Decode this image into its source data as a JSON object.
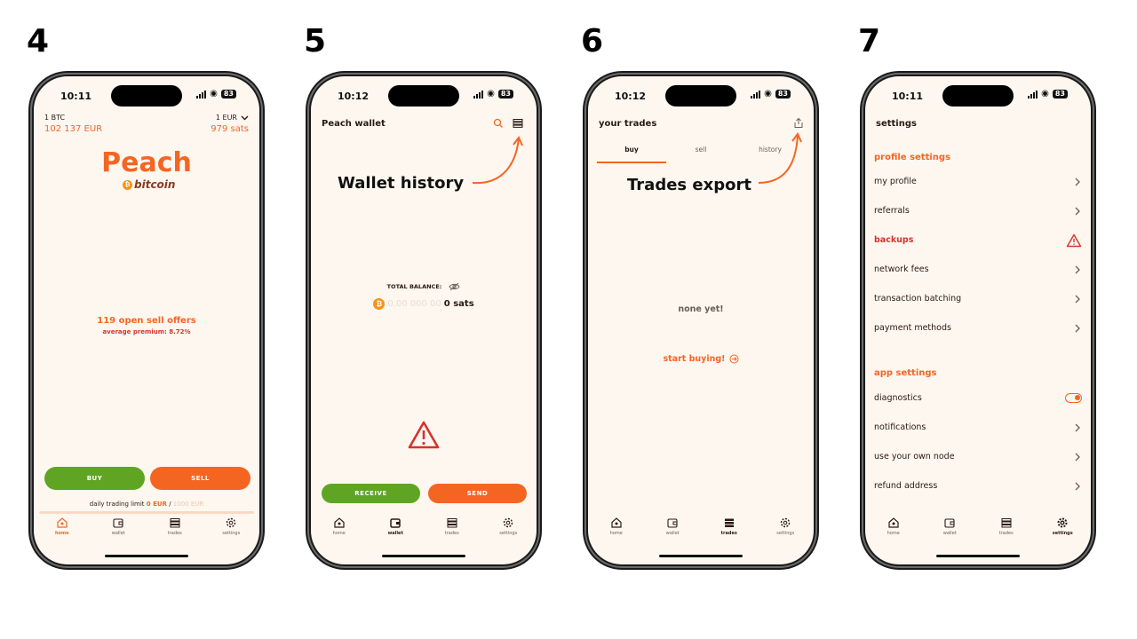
{
  "panels": {
    "p4": {
      "step": "4",
      "time": "10:11",
      "battery": "83",
      "btc_unit": "1 BTC",
      "btc_price": "102 137 EUR",
      "eur_unit": "1 EUR",
      "eur_sats": "979 sats",
      "logo_main": "Peach",
      "logo_sub": "bitcoin",
      "offers": "119 open sell offers",
      "premium": "average premium: 8.72%",
      "buy": "BUY",
      "sell": "SELL",
      "limit_label": "daily trading limit",
      "limit_used": "0 EUR",
      "limit_sep": "/",
      "limit_max": "1000 EUR"
    },
    "p5": {
      "step": "5",
      "time": "10:12",
      "battery": "83",
      "title": "Peach wallet",
      "annotation": "Wallet history",
      "balance_label": "TOTAL BALANCE:",
      "balance_faded": "0.00 000 00",
      "balance_value": "0 sats",
      "receive": "RECEIVE",
      "send": "SEND"
    },
    "p6": {
      "step": "6",
      "time": "10:12",
      "battery": "83",
      "title": "your trades",
      "tabs": [
        "buy",
        "sell",
        "history"
      ],
      "annotation": "Trades export",
      "empty": "none yet!",
      "cta": "start buying!"
    },
    "p7": {
      "step": "7",
      "time": "10:11",
      "battery": "83",
      "title": "settings",
      "profile_section": "profile settings",
      "profile_items": [
        "my profile",
        "referrals",
        "backups",
        "network fees",
        "transaction batching",
        "payment methods"
      ],
      "app_section": "app settings",
      "app_items": [
        "diagnostics",
        "notifications",
        "use your own node",
        "refund address"
      ]
    }
  },
  "tabbar": [
    "home",
    "wallet",
    "trades",
    "settings"
  ],
  "colors": {
    "accent": "#f56522",
    "green": "#5fa523",
    "background": "#fdf7f0",
    "warning": "#d7322c"
  }
}
